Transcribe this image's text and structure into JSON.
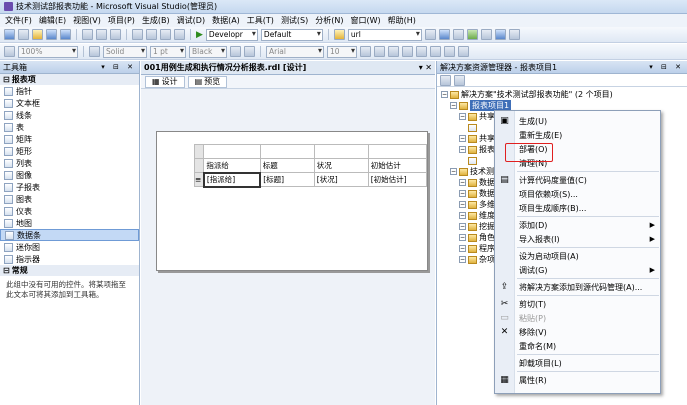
{
  "window": {
    "title": "技术测试部报表功能 - Microsoft Visual Studio(管理员)"
  },
  "menu": [
    "文件(F)",
    "编辑(E)",
    "视图(V)",
    "项目(P)",
    "生成(B)",
    "调试(D)",
    "数据(A)",
    "工具(T)",
    "测试(S)",
    "分析(N)",
    "窗口(W)",
    "帮助(H)"
  ],
  "toolbar1": {
    "config": "Developr",
    "platform": "Default",
    "find": "url"
  },
  "toolbar2": {
    "zoom": "100%",
    "line_style": "Solid",
    "line_width": "1 pt",
    "color": "Black",
    "font": "Arial",
    "size": "10"
  },
  "toolbox": {
    "title": "工具箱",
    "section_items": "报表项",
    "items": [
      "指针",
      "文本框",
      "线条",
      "表",
      "矩阵",
      "矩形",
      "列表",
      "图像",
      "子报表",
      "图表",
      "仪表",
      "地图",
      "数据条",
      "迷你图",
      "指示器"
    ],
    "selected_index": 12,
    "section_general": "常规",
    "general_desc": "此组中没有可用的控件。将某项拖至此文本可将其添加到工具箱。"
  },
  "editor": {
    "doc_tab": "001用例生成和执行情况分析报表.rdl [设计]",
    "subtabs": [
      "设计",
      "预览"
    ],
    "table_header": [
      "指派给",
      "标题",
      "状况",
      "初始估计"
    ],
    "table_row": [
      "[指派给]",
      "[标题]",
      "[状况]",
      "[初始估计]"
    ]
  },
  "solution": {
    "title": "解决方案资源管理器 - 报表项目1",
    "tree": [
      {
        "label": "解决方案\"技术测试部报表功能\" (2 个项目)",
        "indent": 0,
        "kind": "sln"
      },
      {
        "label": "报表项目1",
        "indent": 1,
        "kind": "proj",
        "highlight": true
      },
      {
        "label": "共享",
        "indent": 2,
        "kind": "folder"
      },
      {
        "label": "",
        "indent": 3,
        "kind": "file"
      },
      {
        "label": "共享",
        "indent": 2,
        "kind": "folder"
      },
      {
        "label": "报表",
        "indent": 2,
        "kind": "folder"
      },
      {
        "label": "",
        "indent": 3,
        "kind": "file"
      },
      {
        "label": "技术测",
        "indent": 1,
        "kind": "proj"
      },
      {
        "label": "数据",
        "indent": 2,
        "kind": "folder"
      },
      {
        "label": "数据",
        "indent": 2,
        "kind": "folder"
      },
      {
        "label": "多维",
        "indent": 2,
        "kind": "folder"
      },
      {
        "label": "维度",
        "indent": 2,
        "kind": "folder"
      },
      {
        "label": "挖掘",
        "indent": 2,
        "kind": "folder"
      },
      {
        "label": "角色",
        "indent": 2,
        "kind": "folder"
      },
      {
        "label": "程序",
        "indent": 2,
        "kind": "folder"
      },
      {
        "label": "杂项",
        "indent": 2,
        "kind": "folder"
      }
    ]
  },
  "context_menu": {
    "items": [
      {
        "label": "生成(U)",
        "icon": "build-icon"
      },
      {
        "label": "重新生成(E)"
      },
      {
        "label": "部署(O)"
      },
      {
        "label": "清理(N)"
      },
      {
        "sep": true
      },
      {
        "label": "计算代码度量值(C)",
        "icon": "metrics-icon"
      },
      {
        "label": "项目依赖项(S)..."
      },
      {
        "label": "项目生成顺序(B)..."
      },
      {
        "sep": true
      },
      {
        "label": "添加(D)",
        "submenu": true
      },
      {
        "label": "导入报表(I)",
        "submenu": true
      },
      {
        "sep": true
      },
      {
        "label": "设为启动项目(A)"
      },
      {
        "label": "调试(G)",
        "submenu": true
      },
      {
        "sep": true
      },
      {
        "label": "将解决方案添加到源代码管理(A)...",
        "icon": "source-control-icon"
      },
      {
        "sep": true
      },
      {
        "label": "剪切(T)",
        "icon": "cut-icon"
      },
      {
        "label": "粘贴(P)",
        "icon": "paste-icon",
        "disabled": true
      },
      {
        "label": "移除(V)",
        "icon": "remove-icon"
      },
      {
        "label": "重命名(M)"
      },
      {
        "sep": true
      },
      {
        "label": "卸载项目(L)"
      },
      {
        "sep": true
      },
      {
        "label": "属性(R)",
        "icon": "properties-icon"
      }
    ]
  }
}
